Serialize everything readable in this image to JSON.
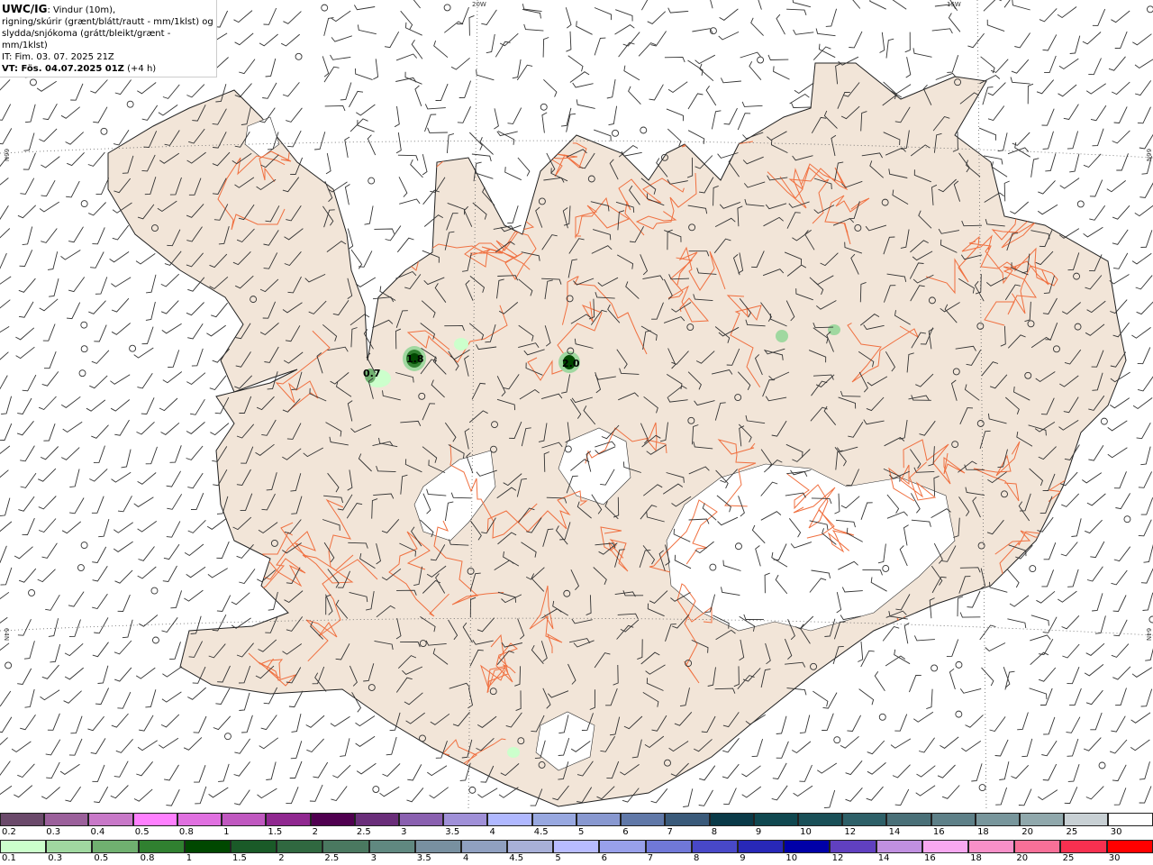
{
  "header": {
    "model": "UWC/IG",
    "line1": ": Vindur (10m),",
    "line2": "rigning/skúrir (grænt/blátt/rautt - mm/1klst) og",
    "line3": "slydda/snjókoma (grátt/bleikt/grænt - mm/1klst)",
    "issue_time": "IT: Fim. 03. 07. 2025 21Z",
    "valid_time": "VT: Fös. 04.07.2025 01Z",
    "lead_time": "(+4 h)"
  },
  "graticule": {
    "lon_20": "20W",
    "lon_15": "15W",
    "lat_66_left": "66N",
    "lat_66_right": "66N",
    "lat_64_left": "64N",
    "lat_64_right": "64N"
  },
  "map": {
    "land_color": "#f2e5d8",
    "glacier_color": "#ffffff",
    "road_color": "#f07040",
    "precip_maxima": [
      {
        "label": "0.7"
      },
      {
        "label": "1.8"
      },
      {
        "label": "2.0"
      }
    ]
  },
  "legend_snow": {
    "labels": [
      "0.2",
      "0.3",
      "0.4",
      "0.5",
      "0.8",
      "1",
      "1.5",
      "2",
      "2.5",
      "3",
      "3.5",
      "4",
      "4.5",
      "5",
      "6",
      "7",
      "8",
      "9",
      "10",
      "12",
      "14",
      "16",
      "18",
      "20",
      "25",
      "30"
    ],
    "colors": [
      "#6b4a6b",
      "#9b609b",
      "#c878c8",
      "#ff80ff",
      "#e070e0",
      "#c058c0",
      "#902890",
      "#500050",
      "#6a2e7a",
      "#8a60b0",
      "#a090d8",
      "#b0b8ff",
      "#98a8e0",
      "#8898d0",
      "#6078a8",
      "#3a5a7a",
      "#0a3a48",
      "#104850",
      "#1a5058",
      "#2e6068",
      "#4a7078",
      "#5e8088",
      "#78969c",
      "#90a8ac",
      "#c8d0d4",
      "#ffffff"
    ]
  },
  "legend_rain": {
    "labels": [
      "0.1",
      "0.3",
      "0.5",
      "0.8",
      "1",
      "1.5",
      "2",
      "2.5",
      "3",
      "3.5",
      "4",
      "4.5",
      "5",
      "6",
      "7",
      "8",
      "9",
      "10",
      "12",
      "14",
      "16",
      "18",
      "20",
      "25",
      "30"
    ],
    "colors": [
      "#ccffcc",
      "#a0d8a0",
      "#70b070",
      "#308030",
      "#004800",
      "#1a5a28",
      "#306840",
      "#4a7860",
      "#608880",
      "#7890a0",
      "#90a0c0",
      "#a8b0d8",
      "#b8bcff",
      "#98a0ea",
      "#7078d8",
      "#4848c8",
      "#2828b8",
      "#0000a8",
      "#6040c0",
      "#c090e0",
      "#f8a8f0",
      "#f890c8",
      "#f87098",
      "#f83050",
      "#ff0000"
    ]
  }
}
